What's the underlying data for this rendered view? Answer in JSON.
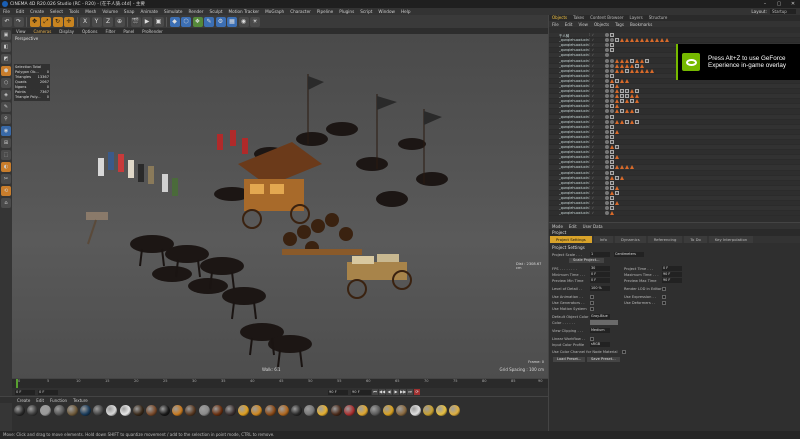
{
  "window": {
    "title": "CINEMA 4D R20.026 Studio (RC - R20) - [在千人骑.c4d] - 主要",
    "controls": [
      "–",
      "▢",
      "✕"
    ]
  },
  "menubar": {
    "items": [
      "File",
      "Edit",
      "Create",
      "Select",
      "Tools",
      "Mesh",
      "Volume",
      "Snap",
      "Animate",
      "Simulate",
      "Render",
      "Sculpt",
      "Motion Tracker",
      "MoGraph",
      "Character",
      "Pipeline",
      "Plugins",
      "Script",
      "Window",
      "Help"
    ],
    "layout_label": "Layout:",
    "layout_value": "Startup"
  },
  "toolbar": {
    "icons": [
      "↶",
      "↷",
      "✥",
      "⤢",
      "↻",
      "✛",
      "X",
      "Y",
      "Z",
      "⊕",
      "🎬",
      "▶",
      "▣",
      "◆",
      "⬡",
      "❖",
      "✎",
      "⚙",
      "▦",
      "◉",
      "☀"
    ]
  },
  "left_tools": [
    "▣",
    "◧",
    "◩",
    "⬢",
    "⬡",
    "◈",
    "✎",
    "⚲",
    "◉",
    "⊞",
    "⬚",
    "◐",
    "✂",
    "⟲",
    "⌂"
  ],
  "viewport": {
    "menu": [
      "View",
      "Cameras",
      "Display",
      "Options",
      "Filter",
      "Panel",
      "ProRender"
    ],
    "label": "Perspective",
    "hud": [
      {
        "label": "Selection Total",
        "value": ""
      },
      {
        "label": "Polygon Ob...",
        "value": "0"
      },
      {
        "label": "Triangles",
        "value": "13367"
      },
      {
        "label": "Quads",
        "value": "2067"
      },
      {
        "label": "Ngons",
        "value": "0"
      },
      {
        "label": "Points",
        "value": "7367"
      },
      {
        "label": "Triangle Poly...",
        "value": "0"
      }
    ],
    "view_label": "Walk: 6.1",
    "grid_spacing": "Grid Spacing : 100 cm",
    "distance_label": "Dist : 2308.67 cm",
    "frame_label": "Frame: 0"
  },
  "timeline": {
    "ticks": [
      "0",
      "5",
      "10",
      "15",
      "20",
      "25",
      "30",
      "35",
      "40",
      "45",
      "50",
      "55",
      "60",
      "65",
      "70",
      "75",
      "80",
      "85",
      "90"
    ],
    "start_field": "0 F",
    "start2_field": "0 F",
    "end_field": "90 F",
    "end2_field": "90 F",
    "buttons": [
      "⏮",
      "◀◀",
      "◀",
      "▶",
      "▶▶",
      "⏭",
      "⟳"
    ],
    "current_frame_label": "0 F"
  },
  "materials": {
    "menu": [
      "Create",
      "Edit",
      "Function",
      "Texture"
    ],
    "swatches": [
      "#2b2b2b",
      "#3a3a3a",
      "#9a9a9a",
      "#555",
      "#6f5a3a",
      "#183a5a",
      "#444",
      "#d9d9d9",
      "#e8e8e8",
      "#3a2a1a",
      "#7a4a2a",
      "#1a1a1a",
      "#c87a20",
      "#5a3a22",
      "#8a8a8a",
      "#6a3010",
      "#3a3030",
      "#e0a020",
      "#d08820",
      "#8a4a18",
      "#b06820",
      "#2a2a2a",
      "#777",
      "#e6b030",
      "#4a2a1a",
      "#aa3030",
      "#e0a830",
      "#5a5a5a",
      "#d8a020",
      "#8a6a40",
      "#e0e0e0",
      "#c8a030",
      "#e8c040",
      "#e0b040"
    ]
  },
  "statusbar": {
    "text": "Move: Click and drag to move elements. Hold down SHIFT to quantize movement / add to the selection in point mode, CTRL to remove."
  },
  "objects_panel": {
    "tabs": [
      "Objects",
      "Takes",
      "Content Browser",
      "Layers",
      "Structure"
    ],
    "menu": [
      "File",
      "Edit",
      "View",
      "Objects",
      "Tags",
      "Bookmarks"
    ],
    "rows": [
      {
        "name": "千人骑",
        "tags": [
          "sph",
          "chk"
        ]
      },
      {
        "name": "_qunqiehuoxiuxin001_1",
        "tags": [
          "sph",
          "sph",
          "chk",
          "tri",
          "tri",
          "tri",
          "tri",
          "tri",
          "tri",
          "tri",
          "tri",
          "tri",
          "tri"
        ]
      },
      {
        "name": "_qunqiehuoxiuxin001_2",
        "tags": [
          "sph",
          "chk"
        ]
      },
      {
        "name": "_qunqiehuoxiuxin001_3",
        "tags": [
          "sph",
          "chk"
        ]
      },
      {
        "name": "_qunqiehuoxiuxin001_4",
        "tags": [
          "sph"
        ]
      },
      {
        "name": "_qunqiehuoxiuxin001_5",
        "tags": [
          "sph",
          "sph",
          "tri",
          "tri",
          "tri",
          "chk",
          "tri",
          "tri",
          "chk"
        ]
      },
      {
        "name": "_qunqiehuoxiuxin001_6",
        "tags": [
          "sph",
          "sph",
          "tri",
          "tri",
          "tri",
          "tri",
          "chk",
          "tri"
        ]
      },
      {
        "name": "_qunqiehuoxiuxin001_7",
        "tags": [
          "sph",
          "sph",
          "tri",
          "tri",
          "chk",
          "tri",
          "tri",
          "tri",
          "tri",
          "tri"
        ]
      },
      {
        "name": "_qunqiehuoxiuxin001_8",
        "tags": [
          "sph",
          "chk"
        ]
      },
      {
        "name": "_qunqiehuoxiuxin001_9",
        "tags": [
          "sph",
          "tri",
          "chk",
          "tri",
          "tri"
        ]
      },
      {
        "name": "_qunqiehuoxiuxin001_10",
        "tags": [
          "sph",
          "chk",
          "tri"
        ]
      },
      {
        "name": "_qunqiehuoxiuxin001_11",
        "tags": [
          "sph",
          "sph",
          "tri",
          "chk",
          "chk",
          "tri",
          "chk"
        ]
      },
      {
        "name": "_qunqiehuoxiuxin001_12",
        "tags": [
          "sph",
          "sph",
          "tri",
          "chk",
          "chk",
          "tri",
          "tri"
        ]
      },
      {
        "name": "_qunqiehuoxiuxin001_13",
        "tags": [
          "sph",
          "sph",
          "tri",
          "chk",
          "tri",
          "chk",
          "tri"
        ]
      },
      {
        "name": "_qunqiehuoxiuxin001_14",
        "tags": [
          "sph",
          "chk",
          "tri"
        ]
      },
      {
        "name": "_qunqiehuoxiuxin001_15",
        "tags": [
          "sph",
          "sph",
          "tri",
          "chk",
          "tri",
          "tri",
          "chk"
        ]
      },
      {
        "name": "_qunqiehuoxiuxin001_16",
        "tags": [
          "sph",
          "chk"
        ]
      },
      {
        "name": "_qunqiehuoxiuxin001_17",
        "tags": [
          "sph",
          "sph",
          "tri",
          "tri",
          "chk",
          "tri",
          "chk"
        ]
      },
      {
        "name": "_qunqiehuoxiuxin001_18",
        "tags": [
          "sph",
          "chk"
        ]
      },
      {
        "name": "_qunqiehuoxiuxin001_19",
        "tags": [
          "sph",
          "chk",
          "tri"
        ]
      },
      {
        "name": "_qunqiehuoxiuxin001_20",
        "tags": [
          "sph",
          "chk"
        ]
      },
      {
        "name": "_qunqiehuoxiuxin001_21",
        "tags": [
          "sph",
          "chk"
        ]
      },
      {
        "name": "_qunqiehuoxiuxin001_22",
        "tags": [
          "sph",
          "tri",
          "chk"
        ]
      },
      {
        "name": "_qunqiehuoxiuxin001_23",
        "tags": [
          "sph",
          "chk"
        ]
      },
      {
        "name": "_qunqiehuoxiuxin001_24",
        "tags": [
          "sph",
          "chk",
          "tri"
        ]
      },
      {
        "name": "_qunqiehuoxiuxin001_25",
        "tags": [
          "sph",
          "chk"
        ]
      },
      {
        "name": "_qunqiehuoxiuxin001_26",
        "tags": [
          "sph",
          "chk",
          "tri",
          "tri",
          "tri",
          "tri"
        ]
      },
      {
        "name": "_qunqiehuoxiuxin001_27",
        "tags": [
          "sph",
          "chk"
        ]
      },
      {
        "name": "_qunqiehuoxiuxin001_28",
        "tags": [
          "sph",
          "tri",
          "chk",
          "tri"
        ]
      },
      {
        "name": "_qunqiehuoxiuxin001_29",
        "tags": [
          "sph",
          "chk"
        ]
      },
      {
        "name": "_qunqiehuoxiuxin001_30",
        "tags": [
          "sph",
          "chk",
          "tri"
        ]
      },
      {
        "name": "_qunqiehuoxiuxin001_31",
        "tags": [
          "sph",
          "tri",
          "chk"
        ]
      },
      {
        "name": "_qunqiehuoxiuxin001_32",
        "tags": [
          "sph",
          "chk"
        ]
      },
      {
        "name": "_qunqiehuoxiuxin001_33",
        "tags": [
          "sph",
          "chk",
          "tri"
        ]
      },
      {
        "name": "_qunqiehuoxiuxin001_34",
        "tags": [
          "sph",
          "chk"
        ]
      },
      {
        "name": "_qunqiehuoxiuxin001_35",
        "tags": [
          "sph",
          "tri"
        ]
      }
    ]
  },
  "overlay": {
    "text": "Press Alt+Z to use GeForce Experience in-game overlay",
    "brand_color": "#76b900"
  },
  "attributes": {
    "menu": [
      "Mode",
      "Edit",
      "User Data"
    ],
    "title": "Project",
    "tabs": [
      "Project Settings",
      "Info",
      "Dynamics",
      "Referencing",
      "To Do",
      "Key Interpolation"
    ],
    "section": "Project Settings",
    "fields": {
      "project_scale_label": "Project Scale . . .",
      "project_scale_value": "1",
      "project_scale_unit": "Centimeters",
      "scale_project_btn": "Scale Project...",
      "fps_label": "FPS . . . . . . . .",
      "fps_value": "30",
      "project_time_label": "Project Time . . .",
      "project_time_value": "0 F",
      "min_time_label": "Minimum Time . . .",
      "min_time_value": "0 F",
      "max_time_label": "Maximum Time . . .",
      "max_time_value": "90 F",
      "preview_min_label": "Preview Min Time",
      "preview_min_value": "0 F",
      "preview_max_label": "Preview Max Time",
      "preview_max_value": "90 F",
      "lod_label": "Level of Detail . .",
      "lod_value": "100 %",
      "render_lod_label": "Render LOD in Editor",
      "use_animation_label": "Use Animation . .",
      "use_expression_label": "Use Expression . .",
      "use_generators_label": "Use Generators . .",
      "use_deformers_label": "Use Deformers . .",
      "use_motion_label": "Use Motion System",
      "default_color_label": "Default Object Color",
      "default_color_value": "Gray-Blue",
      "color_label": "Color . . . . . .",
      "view_clipping_label": "View Clipping . . .",
      "view_clipping_value": "Medium",
      "linear_workflow_label": "Linear Workflow . .",
      "input_color_label": "Input Color Profile",
      "input_color_value": "sRGB",
      "use_color_channel_label": "Use Color Channel for Node Material"
    },
    "load_preset_btn": "Load Preset...",
    "save_preset_btn": "Save Preset..."
  }
}
